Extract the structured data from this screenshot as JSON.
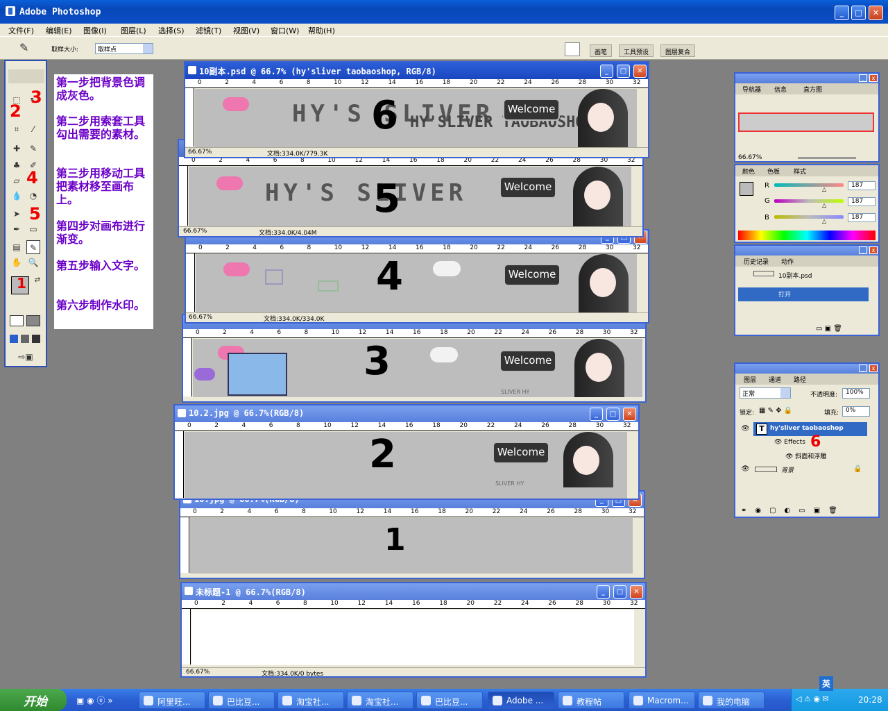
{
  "app": {
    "title": "Adobe Photoshop",
    "min": "_",
    "max": "□",
    "close": "✕"
  },
  "menu": [
    "文件(F)",
    "编辑(E)",
    "图像(I)",
    "图层(L)",
    "选择(S)",
    "滤镜(T)",
    "视图(V)",
    "窗口(W)",
    "帮助(H)"
  ],
  "options": {
    "sample_label": "取样大小:",
    "sample_value": "取样点"
  },
  "palette_well": [
    "画笔",
    "工具预设",
    "图层复合"
  ],
  "toolbox": {
    "markers": [
      "2",
      "3",
      "4",
      "5",
      "1"
    ]
  },
  "steps": [
    "第一步把背景色调成灰色。",
    "第二步用索套工具勾出需要的素材。",
    "第三步用移动工具把素材移至画布上。",
    "第四步对画布进行渐变。",
    "第五步输入文字。",
    "第六步制作水印。"
  ],
  "ruler_ticks": [
    "0",
    "2",
    "4",
    "6",
    "8",
    "10",
    "12",
    "14",
    "16",
    "18",
    "20",
    "22",
    "24",
    "26",
    "28",
    "30",
    "32"
  ],
  "documents": [
    {
      "title": "10副本.psd @ 66.7% (hy'sliver taobaoshop, RGB/8)",
      "zoom": "66.67%",
      "info": "文档:334.0K/779.3K",
      "number": "6",
      "logo": "HY'S SLIVER",
      "watermark": "HY'SLIVER TAOBAOSHOP",
      "welcome": "Welcome"
    },
    {
      "title": "",
      "zoom": "66.67%",
      "info": "文档:334.0K/4.04M",
      "number": "5",
      "logo": "HY'S SLIVER",
      "welcome": "Welcome"
    },
    {
      "title": "",
      "zoom": "66.67%",
      "info": "文档:334.0K/334.0K",
      "number": "4",
      "welcome": "Welcome"
    },
    {
      "title": "",
      "zoom": "",
      "info": "",
      "number": "3",
      "welcome": "Welcome",
      "credit": "SLIVER HY"
    },
    {
      "title": "10.2.jpg @ 66.7%(RGB/8)",
      "zoom": "",
      "info": "",
      "number": "2",
      "welcome": "Welcome",
      "credit": "SLIVER HY"
    },
    {
      "title": "10.jpg @ 66.7%(RGB/8)",
      "zoom": "",
      "info": "",
      "number": "1"
    },
    {
      "title": "未标题-1 @ 66.7%(RGB/8)",
      "zoom": "66.67%",
      "info": "文档:334.0K/0 bytes"
    }
  ],
  "navigator": {
    "tabs": [
      "导航器",
      "信息",
      "直方图"
    ],
    "zoom": "66.67%"
  },
  "color": {
    "tabs": [
      "颜色",
      "色板",
      "样式"
    ],
    "r_label": "R",
    "g_label": "G",
    "b_label": "B",
    "r": "187",
    "g": "187",
    "b": "187",
    "r_frac": 0.73,
    "g_frac": 0.73,
    "b_frac": 0.73,
    "swatch": "#bbbbbb"
  },
  "history": {
    "tabs": [
      "历史记录",
      "动作"
    ],
    "snapshot": "10副本.psd",
    "item": "打开"
  },
  "layers": {
    "tabs": [
      "图层",
      "通道",
      "路径"
    ],
    "blend": "正常",
    "opacity_label": "不透明度:",
    "opacity": "100%",
    "lock_label": "锁定:",
    "fill_label": "填充:",
    "fill": "0%",
    "text_layer": "hy'sliver taobaoshop",
    "effects": "Effects",
    "effect_item": "斜面和浮雕",
    "bg_layer": "背景",
    "marker": "6"
  },
  "taskbar": {
    "start": "开始",
    "items": [
      "阿里旺...",
      "巴比豆...",
      "淘宝社...",
      "淘宝社...",
      "巴比豆...",
      "Adobe ...",
      "教程帖",
      "Macrom...",
      "我的电脑"
    ],
    "ime": "英",
    "time": "20:28"
  }
}
